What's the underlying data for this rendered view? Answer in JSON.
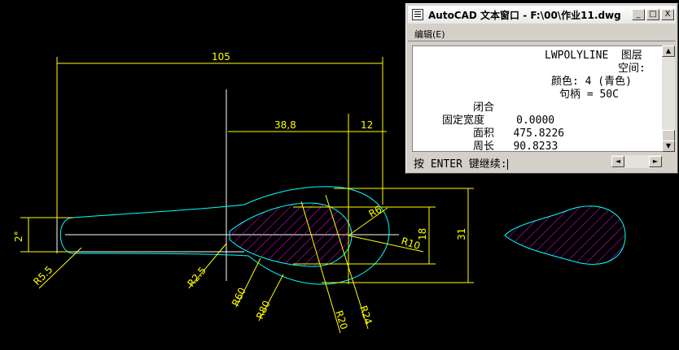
{
  "window": {
    "title": "AutoCAD 文本窗口 - F:\\00\\作业11.dwg",
    "minimize_glyph": "_",
    "maximize_glyph": "□",
    "close_glyph": "X"
  },
  "menu": {
    "edit_label": "编辑(E)"
  },
  "text_lines": [
    "LWPOLYLINE  图层",
    "空间:",
    "颜色: 4 (青色)",
    "句柄 = 50C",
    "闭合",
    "固定宽度     0.0000",
    "面积   475.8226",
    "周长   90.8233"
  ],
  "command": {
    "prompt": "按 ENTER 键继续:"
  },
  "drawing": {
    "dimensions": {
      "overall_length": "105",
      "middle_length": "38,8",
      "right_length": "12",
      "handle_width": "2°",
      "height": "31",
      "bowl_height": "18",
      "r_left": "R5.5",
      "r_inner": "R2.5",
      "r_60": "R60",
      "r_80": "R80",
      "r_20": "R20",
      "r_24": "R24",
      "r_10": "R10",
      "r_6": "R6"
    },
    "colors": {
      "dimension": "#ffff00",
      "outline": "#00ffff",
      "hatch": "#ff00ff",
      "centerline": "#ffffff"
    }
  }
}
